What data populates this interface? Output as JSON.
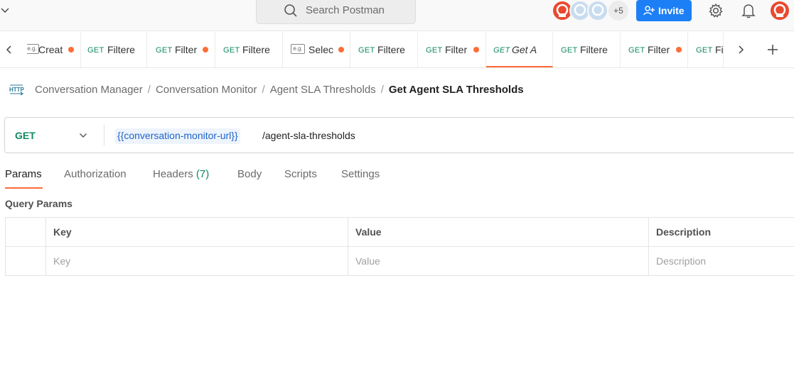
{
  "search": {
    "placeholder": "Search Postman"
  },
  "header": {
    "more_collaborators": "+5",
    "invite_label": "Invite"
  },
  "tabs": [
    {
      "method": "",
      "label": "Creat",
      "type": "example",
      "unsaved": true
    },
    {
      "method": "GET",
      "label": "Filtere",
      "unsaved": false
    },
    {
      "method": "GET",
      "label": "Filter",
      "unsaved": true
    },
    {
      "method": "GET",
      "label": "Filtere",
      "unsaved": false
    },
    {
      "method": "",
      "label": "Selec",
      "type": "example",
      "unsaved": true
    },
    {
      "method": "GET",
      "label": "Filtere",
      "unsaved": false
    },
    {
      "method": "GET",
      "label": "Filter",
      "unsaved": true
    },
    {
      "method": "GET",
      "label": "Get A",
      "unsaved": false,
      "active": true
    },
    {
      "method": "GET",
      "label": "Filtere",
      "unsaved": false
    },
    {
      "method": "GET",
      "label": "Filter",
      "unsaved": true
    },
    {
      "method": "GET",
      "label": "Fi",
      "unsaved": false
    }
  ],
  "breadcrumb": {
    "items": [
      "Conversation Manager",
      "Conversation Monitor",
      "Agent SLA Thresholds"
    ],
    "current": "Get Agent SLA Thresholds",
    "separator": "/"
  },
  "request": {
    "method": "GET",
    "url_variable": "{{conversation-monitor-url}}",
    "url_path": "/agent-sla-thresholds"
  },
  "request_tabs": {
    "params": "Params",
    "authorization": "Authorization",
    "headers": "Headers",
    "headers_count": "(7)",
    "body": "Body",
    "scripts": "Scripts",
    "settings": "Settings"
  },
  "query_params": {
    "title": "Query Params",
    "columns": [
      "Key",
      "Value",
      "Description"
    ],
    "placeholders": [
      "Key",
      "Value",
      "Description"
    ]
  },
  "colors": {
    "accent": "#ff6c37",
    "get_method": "#0f8a5f",
    "invite": "#1d7ff5",
    "variable": "#1e63c9"
  }
}
